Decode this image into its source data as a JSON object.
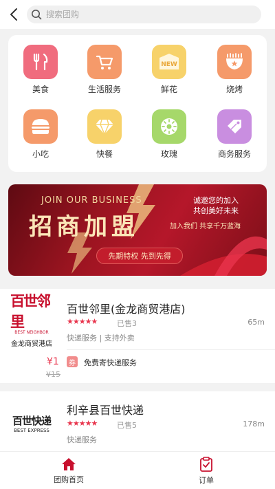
{
  "search": {
    "placeholder": "搜索团购"
  },
  "categories": [
    {
      "label": "美食",
      "icon": "fork-knife-icon",
      "color": "#f06c7e"
    },
    {
      "label": "生活服务",
      "icon": "shopping-cart-icon",
      "color": "#f59a6a"
    },
    {
      "label": "鲜花",
      "icon": "new-tag-icon",
      "color": "#f7d26a"
    },
    {
      "label": "烧烤",
      "icon": "grill-icon",
      "color": "#f59a6a"
    },
    {
      "label": "小吃",
      "icon": "burger-icon",
      "color": "#f59a6a"
    },
    {
      "label": "快餐",
      "icon": "diamond-icon",
      "color": "#f7d26a"
    },
    {
      "label": "玫瑰",
      "icon": "kiwi-icon",
      "color": "#a6d86a"
    },
    {
      "label": "商务服务",
      "icon": "price-tag-icon",
      "color": "#c98ee0"
    }
  ],
  "banner": {
    "en": "JOIN OUR BUSINESS",
    "title": "招商加盟",
    "line1": "诚邀您的加入",
    "line2": "共创美好未来",
    "line3": "加入我们 共享千万蓝海",
    "tag": "先期特权 先到先得"
  },
  "shops": [
    {
      "logo_line1": "百世邻里",
      "logo_line2": "BEST NEIGHBOR",
      "logo_line3": "金龙商贸港店",
      "name": "百世邻里(金龙商贸港店)",
      "stars": "★★★★★",
      "sold": "已售3",
      "distance": "65m",
      "tags": "快递服务 | 支持外卖",
      "price": "¥1",
      "old_price": "¥15",
      "ticket": "券",
      "deal": "免费寄快递服务"
    },
    {
      "logo_line1": "百世快递",
      "logo_line2": "BEST EXPRESS",
      "name": "利辛县百世快递",
      "stars": "★★★★★",
      "sold": "已售5",
      "distance": "178m",
      "tags": "快递服务"
    }
  ],
  "tabs": [
    {
      "label": "团购首页",
      "icon": "home-icon",
      "color": "#c8102e"
    },
    {
      "label": "订单",
      "icon": "order-icon",
      "color": "#c8102e"
    }
  ],
  "colors": {
    "accent": "#e8344c",
    "brand": "#c8102e"
  }
}
